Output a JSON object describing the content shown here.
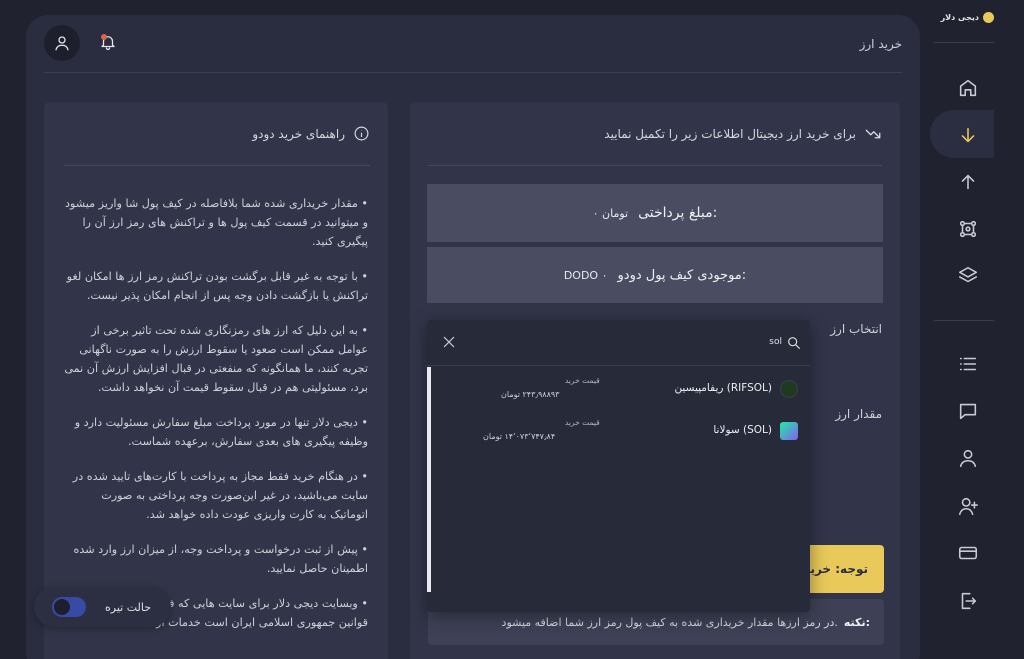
{
  "brand": {
    "name": "دیجی دلار"
  },
  "header": {
    "title": "خرید ارز"
  },
  "sidebar": {
    "items": [
      {
        "icon": "home-icon"
      },
      {
        "icon": "arrow-down-icon",
        "active": true
      },
      {
        "icon": "arrow-up-icon"
      },
      {
        "icon": "network-icon"
      },
      {
        "icon": "layers-icon"
      },
      {
        "icon": "list-icon"
      },
      {
        "icon": "chat-icon"
      },
      {
        "icon": "user-icon"
      },
      {
        "icon": "user-plus-icon"
      },
      {
        "icon": "credit-card-icon"
      },
      {
        "icon": "logout-icon"
      }
    ]
  },
  "guide": {
    "title": "راهنمای خرید دودو",
    "items": [
      "مقدار خریداری شده شما بلافاصله در کیف پول شا واریز میشود و میتوانید در قسمت کیف پول ها و تراکنش های رمز ارز آن را پیگیری کنید.",
      "با توجه به غیر قابل برگشت بودن تراکنش رمز ارز ها امکان لغو تراکنش یا بازگشت دادن وجه پس از انجام امکان پذیر نیست.",
      "به این دلیل که ارز های رمزنگاری شده تحت تاثیر برخی از عوامل ممکن است صعود یا سقوط ارزش را به صورت ناگهانی تجربه کنند، ما همانگونه که منفعتی در قبال افزایش ارزش آن نمی برد، مسئولیتی هم در قبال سقوط قیمت آن نخواهد داشت.",
      "دیجی دلار تنها در مورد پرداخت مبلغ سفارش مسئولیت دارد و وظیفه پیگیری های بعدی سفارش، برعهده شماست.",
      "در هنگام خرید فقط مجاز به پرداخت با کارت‌های تایید شده در سایت می‌باشید، در غیر این‌صورت وجه پرداختی به صورت اتوماتیک به کارت واریزی عودت داده خواهد شد.",
      "پیش از ثبت درخواست و پرداخت وجه، از میزان ارز وارد شده اطمینان حاصل نمایید.",
      "وبسایت دیجی دلار برای سایت هایی که فعالیت آن ها بر خلاف قوانین جمهوری اسلامی ایران است خدمات ارائه"
    ]
  },
  "purchase": {
    "heading": "برای خرید ارز دیجیتال اطلاعات زیر را تکمیل نمایید",
    "payment_label": "مبلغ پرداختی:",
    "payment_value": "۰ تومان",
    "wallet_label": "موجودی کیف پول دودو:",
    "wallet_value": "DODO ۰",
    "select_currency_label": "انتخاب ارز",
    "amount_label": "مقدار ارز",
    "notice_text": "توجه: خرید",
    "note_title": "نکته:",
    "note_text": "در رمز ارزها مقدار خریداری شده به کیف پول رمز ارز شما اضافه میشود."
  },
  "dropdown": {
    "query": "sol",
    "items": [
      {
        "name": "ریفامپیسین (RIFSOL)",
        "price_label": "قیمت خرید",
        "price": "۲۴۳٫۹۸۸۹۳ تومان",
        "icon": "rifsol-coin-icon",
        "color": "#1f3a1f"
      },
      {
        "name": "سولانا (SOL)",
        "price_label": "قیمت خرید",
        "price": "۱۴٬۰۷۳٬۷۴۷٫۸۴ تومان",
        "icon": "sol-coin-icon",
        "color": "#8a5cf0"
      }
    ]
  },
  "theme_toggle": {
    "label": "حالت تیره",
    "enabled": true
  }
}
